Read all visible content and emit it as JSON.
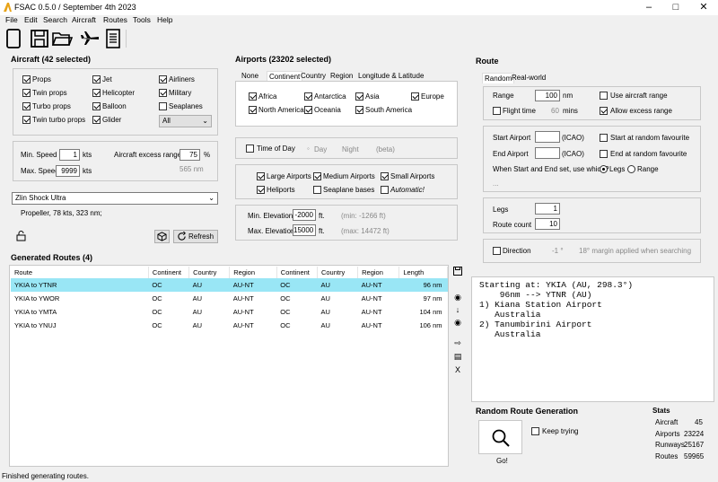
{
  "window": {
    "title": "FSAC 0.5.0 / September 4th 2023"
  },
  "menu": [
    "File",
    "Edit",
    "Search",
    "Aircraft",
    "Routes",
    "Tools",
    "Help"
  ],
  "aircraft": {
    "title": "Aircraft (42 selected)",
    "types": [
      {
        "label": "Props",
        "checked": true
      },
      {
        "label": "Jet",
        "checked": true
      },
      {
        "label": "Airliners",
        "checked": true
      },
      {
        "label": "Twin props",
        "checked": true
      },
      {
        "label": "Helicopter",
        "checked": true
      },
      {
        "label": "Military",
        "checked": true
      },
      {
        "label": "Turbo props",
        "checked": true
      },
      {
        "label": "Balloon",
        "checked": true
      },
      {
        "label": "Seaplanes",
        "checked": false
      },
      {
        "label": "Twin turbo props",
        "checked": true
      },
      {
        "label": "Glider",
        "checked": true
      }
    ],
    "filter_value": "All",
    "min_speed_label": "Min. Speed",
    "min_speed": "1",
    "max_speed_label": "Max. Speed",
    "max_speed": "9999",
    "speed_unit": "kts",
    "excess_range_label": "Aircraft excess range",
    "excess_range": "75",
    "excess_unit": "%",
    "excess_hint": "565 nm",
    "selected_aircraft": "Zlin Shock Ultra",
    "aircraft_info": "Propeller, 78 kts, 323 nm;",
    "refresh_label": "Refresh"
  },
  "airports": {
    "title": "Airports (23202 selected)",
    "tabs": [
      "None",
      "Continent",
      "Country",
      "Region",
      "Longitude & Latitude"
    ],
    "continents": [
      {
        "label": "Africa",
        "checked": true
      },
      {
        "label": "Antarctica",
        "checked": true
      },
      {
        "label": "Asia",
        "checked": true
      },
      {
        "label": "Europe",
        "checked": true
      },
      {
        "label": "North America",
        "checked": true
      },
      {
        "label": "Oceania",
        "checked": true
      },
      {
        "label": "South America",
        "checked": true
      }
    ],
    "time_of_day_label": "Time of Day",
    "day_label": "Day",
    "night_label": "Night",
    "beta_label": "(beta)",
    "types": [
      {
        "label": "Large Airports",
        "checked": true
      },
      {
        "label": "Medium Airports",
        "checked": true
      },
      {
        "label": "Small Airports",
        "checked": true
      },
      {
        "label": "Heliports",
        "checked": true
      },
      {
        "label": "Seaplane bases",
        "checked": false
      },
      {
        "label": "Automatic!",
        "checked": false
      }
    ],
    "min_elev_label": "Min. Elevation",
    "min_elev": "-2000",
    "max_elev_label": "Max. Elevation",
    "max_elev": "15000",
    "elev_unit": "ft.",
    "min_elev_hint": "(min: -1266 ft)",
    "max_elev_hint": "(max: 14472 ft)"
  },
  "route": {
    "title": "Route",
    "tabs": [
      "Random",
      "Real-world"
    ],
    "range_label": "Range",
    "range": "100",
    "range_unit": "nm",
    "use_aircraft_range": "Use aircraft range",
    "flight_time_label": "Flight time",
    "flight_time": "60",
    "flight_time_unit": "mins",
    "allow_excess_range": "Allow excess range",
    "start_airport_label": "Start Airport",
    "end_airport_label": "End Airport",
    "icao_label": "(ICAO)",
    "start_random_fav": "Start at random favourite",
    "end_random_fav": "End at random favourite",
    "which_label": "When Start and End set, use which?",
    "legs_option": "Legs",
    "range_option": "Range",
    "ellipsis": "...",
    "legs_label": "Legs",
    "legs": "1",
    "route_count_label": "Route count",
    "route_count": "10",
    "direction_label": "Direction",
    "direction_value": "-1 °",
    "direction_hint": "18° margin applied when searching"
  },
  "generated": {
    "title": "Generated Routes (4)",
    "columns": [
      "Route",
      "Continent",
      "Country",
      "Region",
      "Continent",
      "Country",
      "Region",
      "Length"
    ],
    "rows": [
      [
        "YKIA to YTNR",
        "OC",
        "AU",
        "AU-NT",
        "OC",
        "AU",
        "AU-NT",
        "96 nm"
      ],
      [
        "YKIA to YWOR",
        "OC",
        "AU",
        "AU-NT",
        "OC",
        "AU",
        "AU-NT",
        "97 nm"
      ],
      [
        "YKIA to YMTA",
        "OC",
        "AU",
        "AU-NT",
        "OC",
        "AU",
        "AU-NT",
        "104 nm"
      ],
      [
        "YKIA to YNUJ",
        "OC",
        "AU",
        "AU-NT",
        "OC",
        "AU",
        "AU-NT",
        "106 nm"
      ]
    ]
  },
  "console": {
    "lines": [
      "Starting at: YKIA (AU, 298.3°)",
      "    96nm --> YTNR (AU)",
      "",
      "1) Kiana Station Airport",
      "   Australia",
      "2) Tanumbirini Airport",
      "   Australia"
    ]
  },
  "random_gen": {
    "title": "Random Route Generation",
    "keep_trying": "Keep trying",
    "go_label": "Go!"
  },
  "stats": {
    "title": "Stats",
    "rows": [
      {
        "label": "Aircraft",
        "value": "45"
      },
      {
        "label": "Airports",
        "value": "23224"
      },
      {
        "label": "Runways",
        "value": "25167"
      },
      {
        "label": "Routes",
        "value": "59965"
      }
    ]
  },
  "status": "Finished generating routes."
}
